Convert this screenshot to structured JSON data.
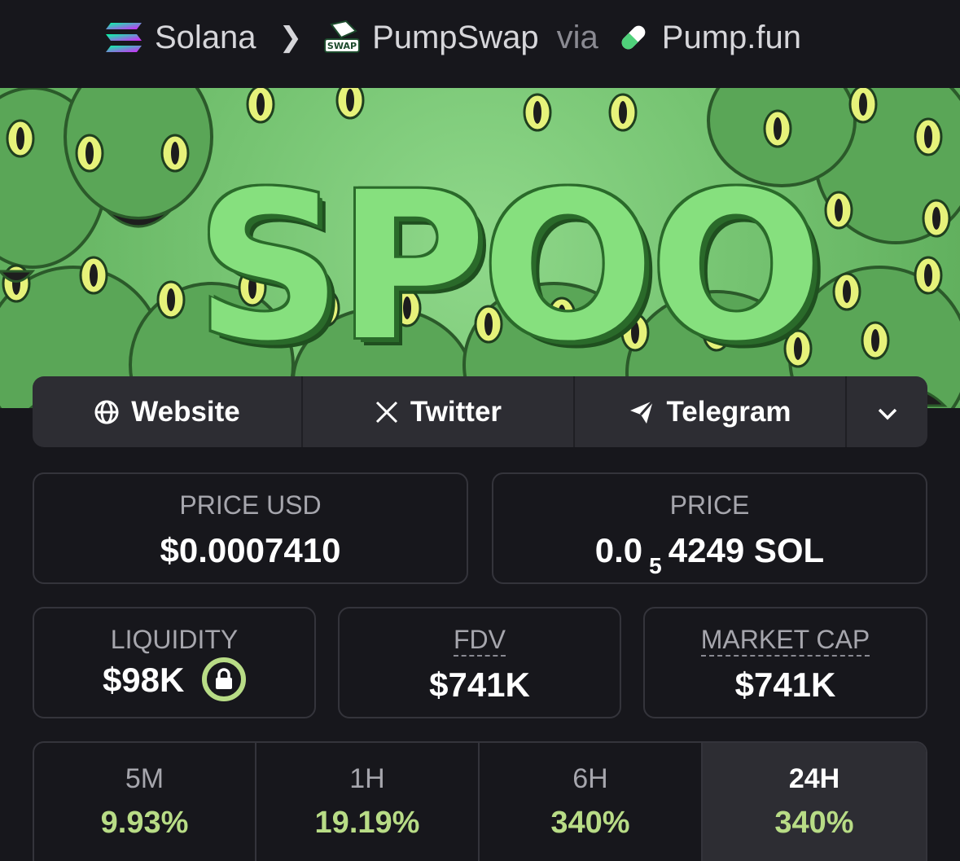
{
  "breadcrumb": {
    "chain": "Solana",
    "dex": "PumpSwap",
    "via": "via",
    "launchpad": "Pump.fun",
    "dex_badge": "SWAP"
  },
  "banner": {
    "text": "SPOO"
  },
  "social": {
    "website": "Website",
    "twitter": "Twitter",
    "telegram": "Telegram"
  },
  "stats": {
    "price_usd_label": "PRICE USD",
    "price_usd": "$0.0007410",
    "price_label": "PRICE",
    "price_sol_prefix": "0.0",
    "price_sol_zeros": "5",
    "price_sol_suffix": "4249 SOL",
    "liquidity_label": "LIQUIDITY",
    "liquidity": "$98K",
    "fdv_label": "FDV",
    "fdv": "$741K",
    "mcap_label": "MARKET CAP",
    "mcap": "$741K"
  },
  "timeframes": [
    {
      "label": "5M",
      "change": "9.93%"
    },
    {
      "label": "1H",
      "change": "19.19%"
    },
    {
      "label": "6H",
      "change": "340%"
    },
    {
      "label": "24H",
      "change": "340%"
    }
  ],
  "colors": {
    "positive": "#b8dc86",
    "panel": "#2d2d33",
    "background": "#17171c"
  }
}
